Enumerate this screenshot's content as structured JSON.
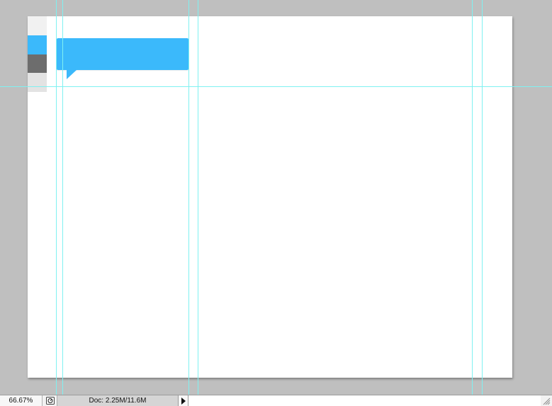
{
  "statusbar": {
    "zoom": "66.67%",
    "doc_info": "Doc: 2.25M/11.6M"
  },
  "icons": {
    "status": "status-info-icon",
    "menu": "play-arrow-icon",
    "resize": "resize-grip-icon"
  },
  "colors": {
    "workspace": "#bfbfbf",
    "canvas": "#ffffff",
    "accent_blue": "#3bb9fb",
    "swatch_light": "#f1f1f1",
    "swatch_dark": "#6d6d6d",
    "swatch_gray": "#e3e3e3",
    "guide": "#7ff1f1"
  }
}
